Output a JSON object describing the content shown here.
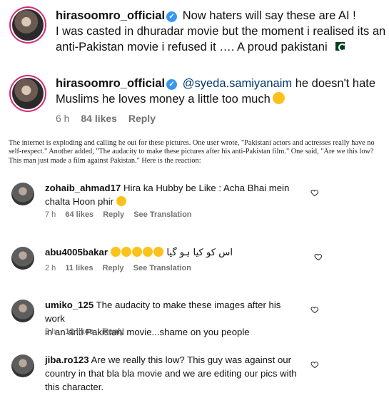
{
  "post_top": {
    "username": "hirasoomro_official",
    "line1": "Now haters will say these are AI !",
    "line2": "I was casted in dhuradar movie but the moment i realised its an",
    "line3": "anti-Pakistan movie i refused it …. A proud pakistani"
  },
  "reply": {
    "username": "hirasoomro_official",
    "mention": "@syeda.samiyanaim",
    "text_inline": "he doesn't hate",
    "text_line2": "Muslims he loves money a little too much",
    "time": "6 h",
    "likes": "84 likes",
    "reply_label": "Reply"
  },
  "article": {
    "text": "The internet is exploding and calling he out for these pictures. One user wrote, \"Pakistani actors and actresses really have no self-respect.\" Another added, \"The audacity to make these pictures after his anti-Pakistan film.\" One said, \"Are we this low? This man just made a film against Pakistan.\" Here is the reaction:"
  },
  "comments": [
    {
      "username": "zohaib_ahmad17",
      "text1": "Hira ka Hubby be Like : Acha Bhai mein",
      "text2": "chalta Hoon phir",
      "time": "7 h",
      "likes": "64 likes",
      "reply": "Reply",
      "translate": "See Translation"
    },
    {
      "username": "abu4005bakar",
      "urdu": "اس کو کیا ہو گیا",
      "time": "2 h",
      "likes": "11 likes",
      "reply": "Reply",
      "translate": "See Translation"
    },
    {
      "username": "umiko_125",
      "text1": "The audacity to make these images after his work",
      "text2": "in an anti Pakistani movie...shame on you people",
      "time": "2 h",
      "likes": "12 likes",
      "reply": "Reply"
    },
    {
      "username": "jiba.ro123",
      "text1": "Are we really this low? This guy was against our",
      "text2": "country in that bla bla movie and we are editing our pics with",
      "text3": "this character."
    }
  ],
  "colors": {
    "verified": "#3897f0",
    "meta_grey": "#737373",
    "mention": "#00376b"
  },
  "icons": [
    "verified-badge-icon",
    "pakistan-flag-icon",
    "smile-emoji-icon",
    "laugh-emoji-icon",
    "heart-outline-icon"
  ]
}
